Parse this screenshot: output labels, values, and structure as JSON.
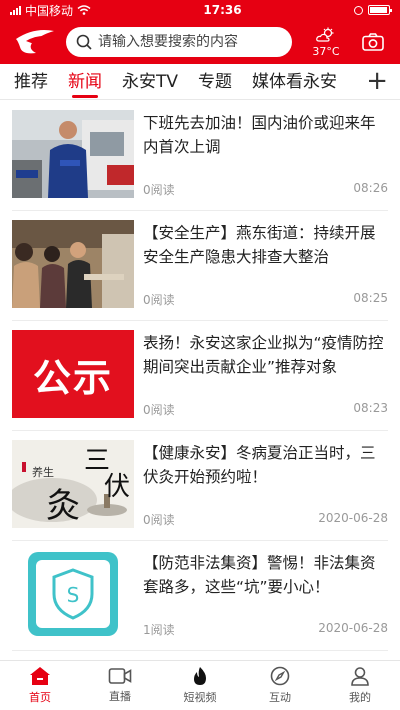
{
  "status_bar": {
    "carrier": "中国移动",
    "time": "17:36"
  },
  "header": {
    "search_placeholder": "请输入想要搜索的内容",
    "weather_temp": "37°C",
    "icons": [
      "logo-icon",
      "search-icon",
      "weather-icon",
      "camera-icon"
    ],
    "accent_color": "#e60012"
  },
  "tabs": [
    {
      "label": "推荐",
      "active": false
    },
    {
      "label": "新闻",
      "active": true
    },
    {
      "label": "永安TV",
      "active": false
    },
    {
      "label": "专题",
      "active": false
    },
    {
      "label": "媒体看永安",
      "active": false
    }
  ],
  "tab_add_label": "+",
  "news": [
    {
      "title": "下班先去加油！国内油价或迎来年内首次上调",
      "reads": "0阅读",
      "time": "08:26"
    },
    {
      "title": "【安全生产】燕东街道：持续开展安全生产隐患大排查大整治",
      "reads": "0阅读",
      "time": "08:25"
    },
    {
      "title": "表扬！永安这家企业拟为“疫情防控期间突出贡献企业”推荐对象",
      "reads": "0阅读",
      "time": "08:23",
      "thumb_text": "公示"
    },
    {
      "title": "【健康永安】冬病夏治正当时，三伏灸开始预约啦！",
      "reads": "0阅读",
      "time": "2020-06-28",
      "thumb_text_1": "三",
      "thumb_text_2": "伏",
      "thumb_text_3": "灸",
      "thumb_text_4": "养生"
    },
    {
      "title": "【防范非法集资】警惕！非法集资套路多，这些“坑”要小心！",
      "reads": "1阅读",
      "time": "2020-06-28"
    }
  ],
  "bottom_nav": [
    {
      "label": "首页",
      "icon": "home-icon",
      "active": true
    },
    {
      "label": "直播",
      "icon": "video-icon",
      "active": false
    },
    {
      "label": "短视频",
      "icon": "flame-icon",
      "active": false
    },
    {
      "label": "互动",
      "icon": "compass-icon",
      "active": false
    },
    {
      "label": "我的",
      "icon": "user-icon",
      "active": false
    }
  ]
}
